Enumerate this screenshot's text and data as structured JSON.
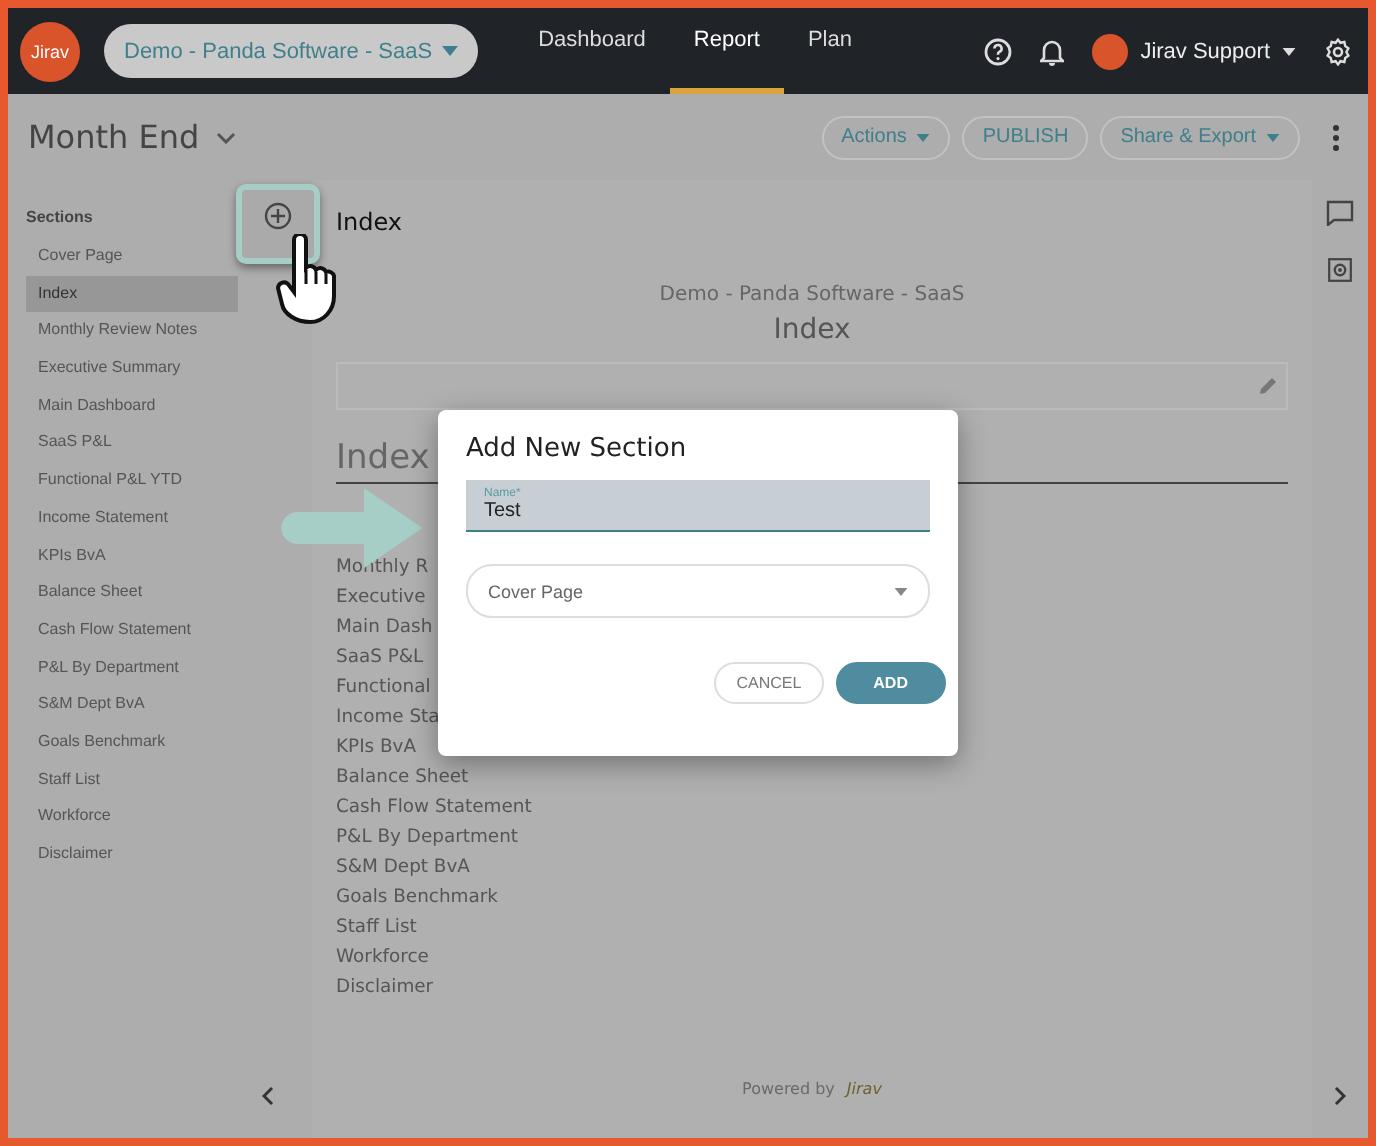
{
  "logo_text": "Jirav",
  "company_selector": {
    "label": "Demo - Panda Software - SaaS"
  },
  "nav_tabs": [
    {
      "label": "Dashboard",
      "selected": false
    },
    {
      "label": "Report",
      "selected": true
    },
    {
      "label": "Plan",
      "selected": false
    }
  ],
  "user_menu": {
    "label": "Jirav Support"
  },
  "report_title": "Month End",
  "toolbar_buttons": [
    {
      "label": "Actions",
      "kind": "dropdown"
    },
    {
      "label": "PUBLISH",
      "kind": "plain"
    },
    {
      "label": "Share & Export",
      "kind": "dropdown"
    }
  ],
  "sidebar": {
    "heading": "Sections",
    "items": [
      {
        "label": "Cover Page",
        "selected": false
      },
      {
        "label": "Index",
        "selected": true
      },
      {
        "label": "Monthly Review Notes",
        "selected": false
      },
      {
        "label": "Executive Summary",
        "selected": false
      },
      {
        "label": "Main Dashboard",
        "selected": false
      },
      {
        "label": "SaaS P&L",
        "selected": false
      },
      {
        "label": "Functional P&L YTD",
        "selected": false
      },
      {
        "label": "Income Statement",
        "selected": false
      },
      {
        "label": "KPIs BvA",
        "selected": false
      },
      {
        "label": "Balance Sheet",
        "selected": false
      },
      {
        "label": "Cash Flow Statement",
        "selected": false
      },
      {
        "label": "P&L By Department",
        "selected": false
      },
      {
        "label": "S&M Dept BvA",
        "selected": false
      },
      {
        "label": "Goals Benchmark",
        "selected": false
      },
      {
        "label": "Staff List",
        "selected": false
      },
      {
        "label": "Workforce",
        "selected": false
      },
      {
        "label": "Disclaimer",
        "selected": false
      }
    ]
  },
  "section_title": "Index",
  "page": {
    "company": "Demo - Panda Software - SaaS",
    "title": "Index",
    "index_heading": "Index",
    "index_items": [
      "Monthly R",
      "Executive",
      "Main Dash",
      "SaaS P&L",
      "Functional",
      "Income Sta",
      "KPIs BvA",
      "Balance Sheet",
      "Cash Flow Statement",
      "P&L By Department",
      "S&M Dept BvA",
      "Goals Benchmark",
      "Staff List",
      "Workforce",
      "Disclaimer"
    ]
  },
  "footer": {
    "powered_by": "Powered by",
    "brand": "Jirav"
  },
  "dialog": {
    "title": "Add New Section",
    "name_field": {
      "label": "Name*",
      "value": "Test"
    },
    "position_select": {
      "value": "Cover Page"
    },
    "buttons": [
      {
        "label": "CANCEL",
        "kind": "secondary"
      },
      {
        "label": "ADD",
        "kind": "primary"
      }
    ]
  }
}
